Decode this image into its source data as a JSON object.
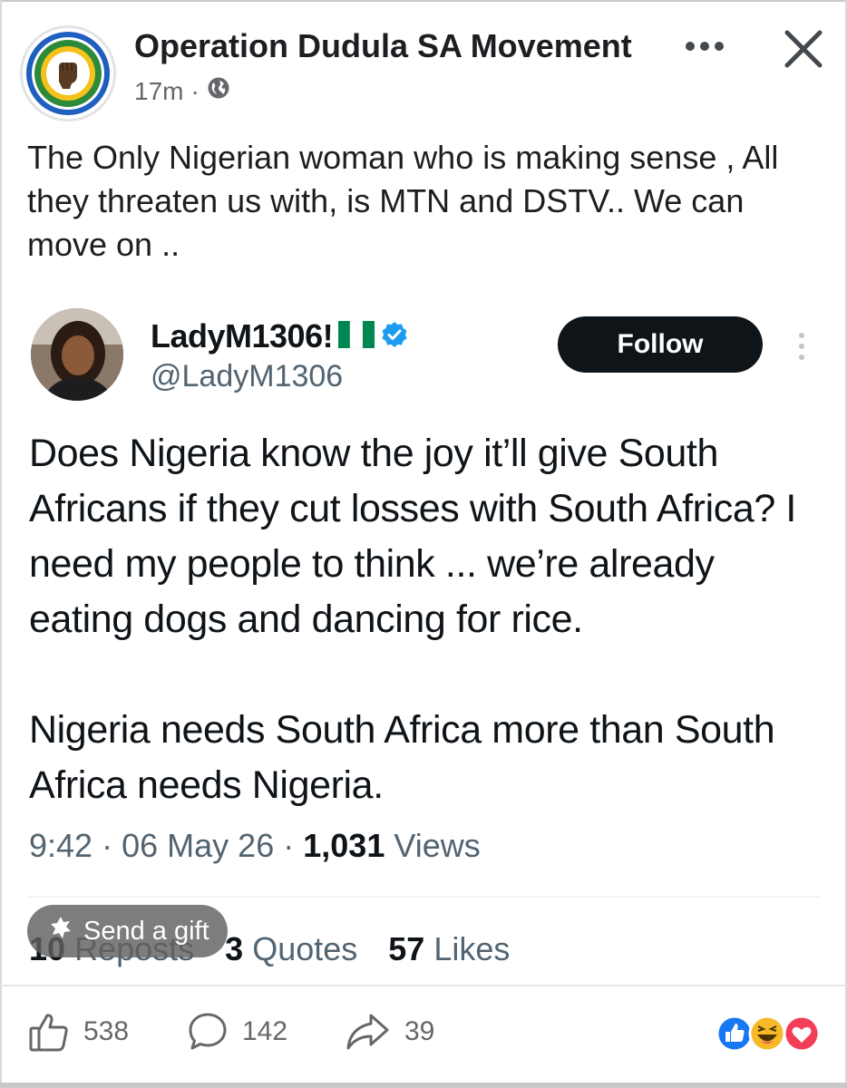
{
  "post": {
    "page_name": "Operation Dudula SA Movement",
    "time": "17m",
    "meta_sep": "·",
    "caption": "The Only Nigerian woman who is making sense , All they threaten us with, is MTN and DSTV.. We can move on .."
  },
  "tweet": {
    "display_name": "LadyM1306!",
    "handle": "@LadyM1306",
    "follow_label": "Follow",
    "paragraph_1": "Does Nigeria know the joy it’ll give South Africans if they cut losses with South Africa? I need my people to think ... we’re already eating dogs and dancing for rice.",
    "paragraph_2": "Nigeria needs South Africa more than South Africa needs Nigeria.",
    "time": "9:42",
    "date": "06 May 26",
    "dot": "·",
    "views_count": "1,031",
    "views_label": "Views",
    "reposts_count": "10",
    "reposts_label": "Reposts",
    "quotes_count": "3",
    "quotes_label": "Quotes",
    "likes_count": "57",
    "likes_label": "Likes"
  },
  "overlay": {
    "send_gift_label": "Send a gift"
  },
  "actions": {
    "likes": "538",
    "comments": "142",
    "shares": "39"
  },
  "colors": {
    "text": "#1c1e21",
    "secondary": "#65676b",
    "tweet_text": "#0f1419",
    "tweet_secondary": "#536471",
    "verified": "#1d9bf0",
    "like_blue": "#1877f2",
    "love_red": "#f33e58",
    "haha_yellow": "#f7b928"
  },
  "icons": {
    "globe": "globe-icon",
    "more": "more-horizontal-icon",
    "close": "close-icon",
    "verified": "verified-badge-icon",
    "flag": "nigeria-flag-icon",
    "gift": "gift-icon",
    "like": "thumbs-up-icon",
    "comment": "comment-icon",
    "share": "share-icon"
  }
}
